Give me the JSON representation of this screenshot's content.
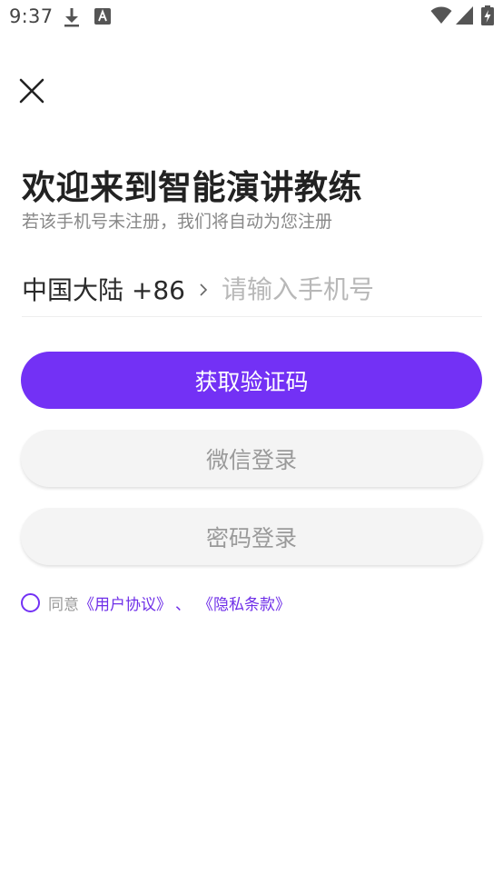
{
  "status_bar": {
    "time": "9:37",
    "icons": [
      "download-icon",
      "a-icon",
      "wifi-icon",
      "signal-icon",
      "battery-icon"
    ]
  },
  "header": {
    "close_icon": "close-icon"
  },
  "main": {
    "title": "欢迎来到智能演讲教练",
    "subtitle": "若该手机号未注册，我们将自动为您注册",
    "region_label": "中国大陆 +86",
    "phone_value": "",
    "phone_placeholder": "请输入手机号"
  },
  "buttons": {
    "get_code": "获取验证码",
    "wechat_login": "微信登录",
    "password_login": "密码登录"
  },
  "agreement": {
    "prefix": "同意",
    "user_agreement": "《用户协议》",
    "separator": "、",
    "privacy_policy": "《隐私条款》",
    "checked": false
  },
  "colors": {
    "accent": "#7331f5",
    "secondary_bg": "#f4f4f4",
    "muted_text": "#888888"
  }
}
